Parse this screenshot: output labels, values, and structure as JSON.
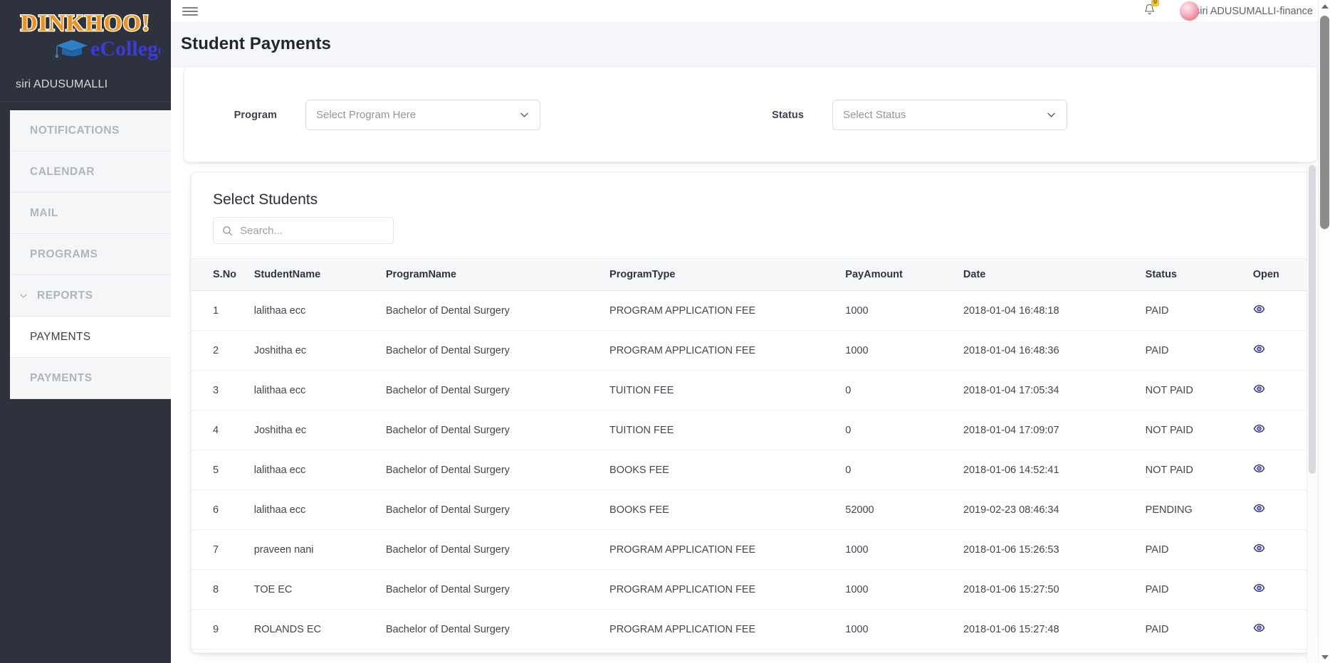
{
  "brand": {
    "logo_primary_text": "DINKHOO!",
    "logo_secondary_text": "eCollege",
    "logo_primary_color": "#f0911f",
    "logo_secondary_color": "#3b3bd6",
    "user": "siri ADUSUMALLI"
  },
  "sidebar": {
    "items": [
      {
        "label": "NOTIFICATIONS",
        "type": "top"
      },
      {
        "label": "CALENDAR",
        "type": "top"
      },
      {
        "label": "MAIL",
        "type": "top"
      },
      {
        "label": "PROGRAMS",
        "type": "top"
      },
      {
        "label": "REPORTS",
        "type": "group",
        "icon": "chevron-down-icon"
      },
      {
        "label": "PAYMENTS",
        "type": "sub"
      },
      {
        "label": "PAYMENTS",
        "type": "top"
      }
    ]
  },
  "topbar": {
    "menu_icon": "hamburger-icon",
    "bell_icon": "notification-bell-icon",
    "bell_count": "0",
    "avatar": "user-avatar",
    "user_name": "siri ADUSUMALLI-finance"
  },
  "header": {
    "title": "Student Payments"
  },
  "filters": {
    "program": {
      "label": "Program",
      "value": "Select Program Here",
      "caret": "chevron-down-icon"
    },
    "status": {
      "label": "Status",
      "value": "Select Status",
      "caret": "chevron-down-icon"
    }
  },
  "students": {
    "title": "Select Students",
    "search": {
      "icon": "search-icon",
      "value": "",
      "placeholder": "Search..."
    },
    "columns": [
      "S.No",
      "StudentName",
      "ProgramName",
      "ProgramType",
      "PayAmount",
      "Date",
      "Status",
      "Open"
    ],
    "open_icon": "eye-icon",
    "rows": [
      {
        "sno": "1",
        "student": "lalithaa ecc",
        "program": "Bachelor of Dental Surgery",
        "type": "PROGRAM APPLICATION FEE",
        "amount": "1000",
        "date": "2018-01-04 16:48:18",
        "status": "PAID"
      },
      {
        "sno": "2",
        "student": "Joshitha ec",
        "program": "Bachelor of Dental Surgery",
        "type": "PROGRAM APPLICATION FEE",
        "amount": "1000",
        "date": "2018-01-04 16:48:36",
        "status": "PAID"
      },
      {
        "sno": "3",
        "student": "lalithaa ecc",
        "program": "Bachelor of Dental Surgery",
        "type": "TUITION FEE",
        "amount": "0",
        "date": "2018-01-04 17:05:34",
        "status": "NOT PAID"
      },
      {
        "sno": "4",
        "student": "Joshitha ec",
        "program": "Bachelor of Dental Surgery",
        "type": "TUITION FEE",
        "amount": "0",
        "date": "2018-01-04 17:09:07",
        "status": "NOT PAID"
      },
      {
        "sno": "5",
        "student": "lalithaa ecc",
        "program": "Bachelor of Dental Surgery",
        "type": "BOOKS FEE",
        "amount": "0",
        "date": "2018-01-06 14:52:41",
        "status": "NOT PAID"
      },
      {
        "sno": "6",
        "student": "lalithaa ecc",
        "program": "Bachelor of Dental Surgery",
        "type": "BOOKS FEE",
        "amount": "52000",
        "date": "2019-02-23 08:46:34",
        "status": "PENDING"
      },
      {
        "sno": "7",
        "student": "praveen nani",
        "program": "Bachelor of Dental Surgery",
        "type": "PROGRAM APPLICATION FEE",
        "amount": "1000",
        "date": "2018-01-06 15:26:53",
        "status": "PAID"
      },
      {
        "sno": "8",
        "student": "TOE EC",
        "program": "Bachelor of Dental Surgery",
        "type": "PROGRAM APPLICATION FEE",
        "amount": "1000",
        "date": "2018-01-06 15:27:50",
        "status": "PAID"
      },
      {
        "sno": "9",
        "student": "ROLANDS EC",
        "program": "Bachelor of Dental Surgery",
        "type": "PROGRAM APPLICATION FEE",
        "amount": "1000",
        "date": "2018-01-06 15:27:48",
        "status": "PAID"
      }
    ]
  },
  "colors": {
    "sidebar_bg": "#2e323c",
    "page_bg": "#f4f6f9",
    "accent_eye": "#2a2c8e",
    "badge": "#f5c33b"
  }
}
